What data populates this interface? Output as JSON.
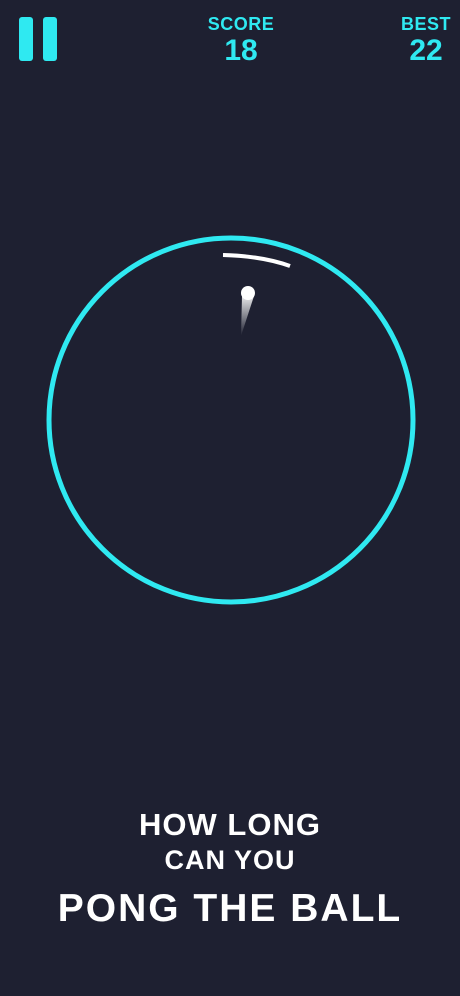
{
  "hud": {
    "score_label": "SCORE",
    "score_value": "18",
    "best_label": "BEST",
    "best_value": "22",
    "pause_icon": "pause-icon"
  },
  "game": {
    "ring_color": "#2fe9f1",
    "paddle_color": "#ffffff",
    "ball_color": "#ffffff",
    "background_color": "#1e2031"
  },
  "tagline": {
    "line1": "HOW LONG",
    "line2": "CAN YOU",
    "line3": "PONG THE BALL"
  }
}
